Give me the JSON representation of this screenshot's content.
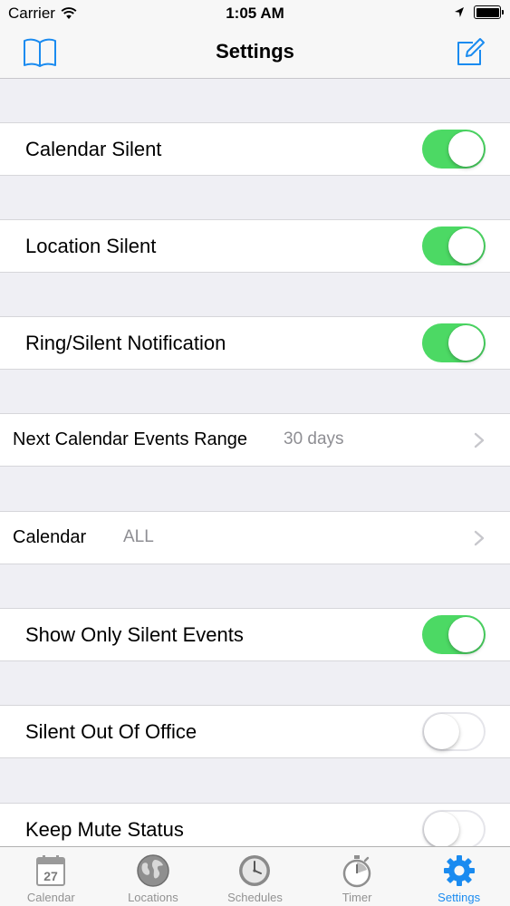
{
  "status_bar": {
    "carrier": "Carrier",
    "time": "1:05 AM"
  },
  "nav": {
    "title": "Settings",
    "left_icon": "book-icon",
    "right_icon": "compose-icon",
    "accent_color": "#1a8bf0"
  },
  "settings": {
    "calendar_silent": {
      "label": "Calendar Silent",
      "on": true
    },
    "location_silent": {
      "label": "Location Silent",
      "on": true
    },
    "ring_silent_notification": {
      "label": "Ring/Silent Notification",
      "on": true
    },
    "next_calendar_events_range": {
      "label": "Next Calendar Events Range",
      "value": "30 days"
    },
    "calendar": {
      "label": "Calendar",
      "value": "ALL"
    },
    "show_only_silent_events": {
      "label": "Show Only Silent Events",
      "on": true
    },
    "silent_out_of_office": {
      "label": "Silent Out Of Office",
      "on": false
    },
    "keep_mute_status": {
      "label": "Keep Mute Status",
      "on": false
    }
  },
  "colors": {
    "toggle_on": "#4cd964",
    "background": "#efeff4",
    "secondary_text": "#8e8e93"
  },
  "tab_bar": {
    "tabs": [
      {
        "label": "Calendar",
        "icon": "calendar-icon",
        "active": false,
        "calendar_day": "27"
      },
      {
        "label": "Locations",
        "icon": "globe-icon",
        "active": false
      },
      {
        "label": "Schedules",
        "icon": "clock-icon",
        "active": false
      },
      {
        "label": "Timer",
        "icon": "stopwatch-icon",
        "active": false
      },
      {
        "label": "Settings",
        "icon": "gear-icon",
        "active": true
      }
    ]
  }
}
